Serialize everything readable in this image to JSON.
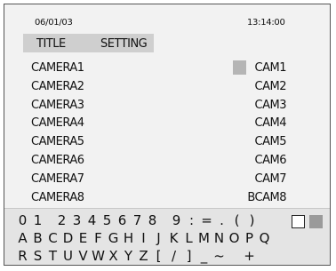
{
  "header": {
    "date": "06/01/03",
    "time": "13:14:00"
  },
  "tabs": [
    {
      "label": "TITLE"
    },
    {
      "label": "SETTING"
    }
  ],
  "cameras": [
    {
      "name": "CAMERA1",
      "title": "CAM1"
    },
    {
      "name": "CAMERA2",
      "title": "CAM2"
    },
    {
      "name": "CAMERA3",
      "title": "CAM3"
    },
    {
      "name": "CAMERA4",
      "title": "CAM4"
    },
    {
      "name": "CAMERA5",
      "title": "CAM5"
    },
    {
      "name": "CAMERA6",
      "title": "CAM6"
    },
    {
      "name": "CAMERA7",
      "title": "CAM7"
    },
    {
      "name": "CAMERA8",
      "title": "BCAM8"
    }
  ],
  "keyboard": {
    "row1": [
      "0",
      "1",
      " ",
      "2",
      "3",
      "4",
      "5",
      "6",
      "7",
      "8",
      " ",
      "9",
      ":",
      "=",
      ".",
      "(",
      ")"
    ],
    "row2": [
      "A",
      "B",
      "C",
      "D",
      "E",
      "F",
      "G",
      "H",
      "I",
      "J",
      "K",
      "L",
      "M",
      "N",
      "O",
      "P",
      "Q"
    ],
    "row3": [
      "R",
      "S",
      "T",
      "U",
      "V",
      "W",
      "X",
      "Y",
      "Z",
      "[",
      "/",
      "]",
      "_",
      "~",
      " ",
      "+"
    ],
    "box_key": "empty-box-icon",
    "delete_key": "filled-box-icon"
  }
}
